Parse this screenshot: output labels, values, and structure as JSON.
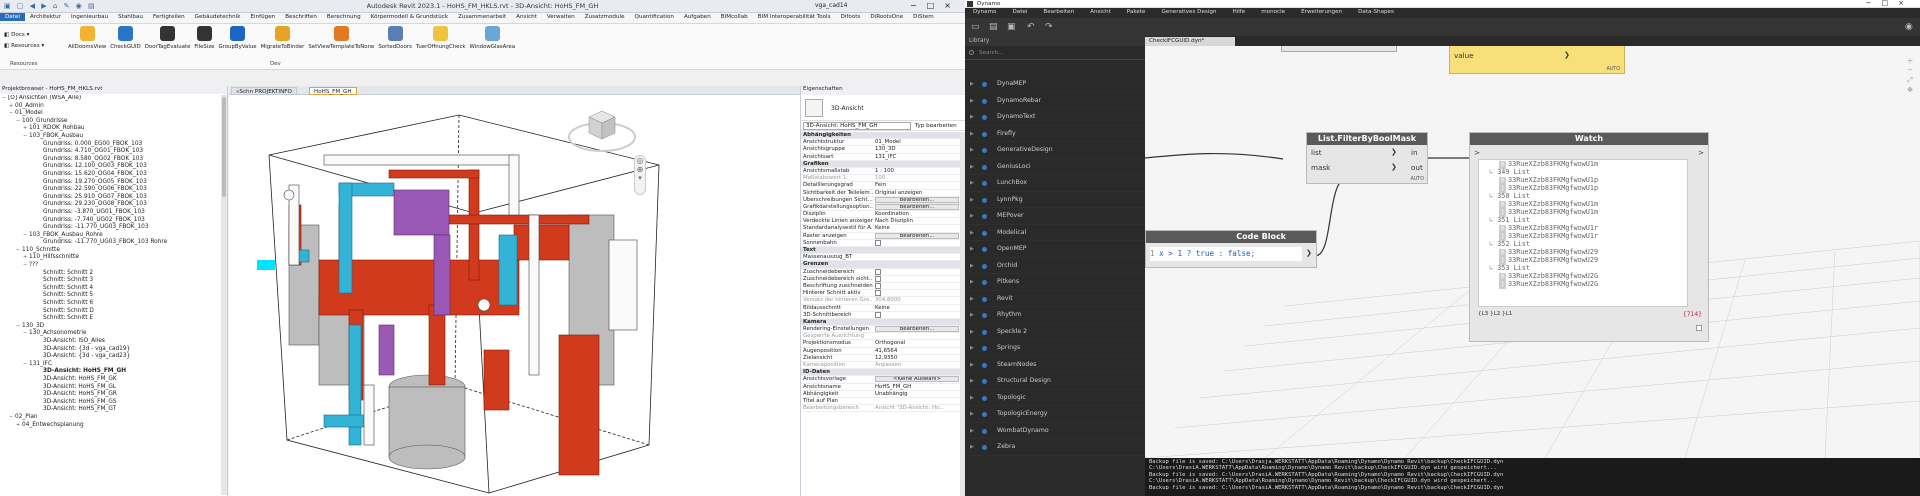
{
  "revit": {
    "window_title": "Autodesk Revit 2023.1 - HoHS_FM_HKLS.rvt - 3D-Ansicht: HoHS_FM_GH",
    "user": "vga_cad14",
    "menu": [
      "Datei",
      "Architektur",
      "Ingenieurbau",
      "Stahlbau",
      "Fertigteilen",
      "Gebäudetechnik",
      "Einfügen",
      "Beschriften",
      "Berechnung",
      "Körpermodell & Grundstück",
      "Zusammenarbeit",
      "Ansicht",
      "Verwalten",
      "Zusatzmodule",
      "Quantification",
      "Aufgaben",
      "BIMcollab",
      "BIM Interoperabilität Tools",
      "Difoots",
      "DiRootsOne",
      "DiStem"
    ],
    "ribbon_left": [
      "Docs",
      "Resources"
    ],
    "ribbon_buttons": [
      "AllDoomsView",
      "CheckGUID",
      "DoorTagEvaluate",
      "FileSize",
      "GroupByValue",
      "MigrateToBinder",
      "SetViewTemplateToNone",
      "SortedDoors",
      "TuerOffnungCheck",
      "WindowGlasArea"
    ],
    "ribbon_groups": [
      "Resources",
      "Dev"
    ],
    "project_browser_title": "Projektbrowser - HoHS_FM_HKLS.rvt",
    "tree": [
      {
        "t": "[O] Ansichten (WSA_Alle)",
        "l": 0,
        "tg": "−"
      },
      {
        "t": "00_Admin",
        "l": 1,
        "tg": "+"
      },
      {
        "t": "01_Model",
        "l": 1,
        "tg": "−"
      },
      {
        "t": "100_Grundrisse",
        "l": 2,
        "tg": "−"
      },
      {
        "t": "101_RDOK_Rohbau",
        "l": 3,
        "tg": "+"
      },
      {
        "t": "103_FBOK_Ausbau",
        "l": 3,
        "tg": "−"
      },
      {
        "t": "Grundriss: 0.000_EG00_FBOK_103",
        "l": 5,
        "tg": ""
      },
      {
        "t": "Grundriss: 4.710_OG01_FBOK_103",
        "l": 5,
        "tg": ""
      },
      {
        "t": "Grundriss: 8.580_OG02_FBOK_103",
        "l": 5,
        "tg": ""
      },
      {
        "t": "Grundriss: 12.100_OG03_FBOK_103",
        "l": 5,
        "tg": ""
      },
      {
        "t": "Grundriss: 15.620_OG04_FBOK_103",
        "l": 5,
        "tg": ""
      },
      {
        "t": "Grundriss: 19.270_OG05_FBOK_103",
        "l": 5,
        "tg": ""
      },
      {
        "t": "Grundriss: 22.590_OG06_FBOK_103",
        "l": 5,
        "tg": ""
      },
      {
        "t": "Grundriss: 25.910_OG07_FBOK_103",
        "l": 5,
        "tg": ""
      },
      {
        "t": "Grundriss: 29.230_OG08_FBOK_103",
        "l": 5,
        "tg": ""
      },
      {
        "t": "Grundriss: -3.870_UG01_FBOK_103",
        "l": 5,
        "tg": ""
      },
      {
        "t": "Grundriss: -7.740_UG02_FBOK_103",
        "l": 5,
        "tg": ""
      },
      {
        "t": "Grundriss: -11.770_UG03_FBOK_103",
        "l": 5,
        "tg": ""
      },
      {
        "t": "103_FBOK_Ausbau_Rohre",
        "l": 3,
        "tg": "−"
      },
      {
        "t": "Grundriss: -11.770_UG03_FBOK_103 Rohre",
        "l": 5,
        "tg": ""
      },
      {
        "t": "110_Schnitte",
        "l": 2,
        "tg": "−"
      },
      {
        "t": "110_Hilfsschnitte",
        "l": 3,
        "tg": "+"
      },
      {
        "t": "???",
        "l": 3,
        "tg": "−"
      },
      {
        "t": "Schnitt: Schnitt 2",
        "l": 5,
        "tg": ""
      },
      {
        "t": "Schnitt: Schnitt 3",
        "l": 5,
        "tg": ""
      },
      {
        "t": "Schnitt: Schnitt 4",
        "l": 5,
        "tg": ""
      },
      {
        "t": "Schnitt: Schnitt 5",
        "l": 5,
        "tg": ""
      },
      {
        "t": "Schnitt: Schnitt 6",
        "l": 5,
        "tg": ""
      },
      {
        "t": "Schnitt: Schnitt D",
        "l": 5,
        "tg": ""
      },
      {
        "t": "Schnitt: Schnitt E",
        "l": 5,
        "tg": ""
      },
      {
        "t": "130_3D",
        "l": 2,
        "tg": "−"
      },
      {
        "t": "130_Achsonometrie",
        "l": 3,
        "tg": "−"
      },
      {
        "t": "3D-Ansicht: ISO_Alles",
        "l": 5,
        "tg": ""
      },
      {
        "t": "3D-Ansicht: {3d - vga_cad19}",
        "l": 5,
        "tg": ""
      },
      {
        "t": "3D-Ansicht: {3d - vga_cad23}",
        "l": 5,
        "tg": ""
      },
      {
        "t": "131_IFC",
        "l": 3,
        "tg": "−"
      },
      {
        "t": "3D-Ansicht: HoHS_FM_GH",
        "l": 5,
        "tg": "",
        "b": true
      },
      {
        "t": "3D-Ansicht: HoHS_FM_GK",
        "l": 5,
        "tg": ""
      },
      {
        "t": "3D-Ansicht: HoHS_FM_GL",
        "l": 5,
        "tg": ""
      },
      {
        "t": "3D-Ansicht: HoHS_FM_GR",
        "l": 5,
        "tg": ""
      },
      {
        "t": "3D-Ansicht: HoHS_FM_GS",
        "l": 5,
        "tg": ""
      },
      {
        "t": "3D-Ansicht: HoHS_FM_GT",
        "l": 5,
        "tg": ""
      },
      {
        "t": "02_Plan",
        "l": 1,
        "tg": "−"
      },
      {
        "t": "04_Entwechsplanung",
        "l": 2,
        "tg": "+"
      }
    ],
    "view_tabs": [
      "«Schn PROJEKTINFO",
      "HoHS_FM_GH"
    ],
    "properties_title": "Eigenschaften",
    "prop_type": "3D-Ansicht",
    "prop_sel": "3D-Ansicht: HoHS_FM_GH",
    "prop_edit_type": "Typ bearbeiten",
    "props": [
      {
        "g": "Abhängigkeiten"
      },
      {
        "k": "Ansichtstruktur",
        "v": "01_Model"
      },
      {
        "k": "Ansichtsgruppe",
        "v": "130_3D"
      },
      {
        "k": "Ansichtsart",
        "v": "131_IFC"
      },
      {
        "g": "Grafiken"
      },
      {
        "k": "Ansichtsmaßstab",
        "v": "1 : 100"
      },
      {
        "k": "Maßstabswert 1:",
        "v": "100",
        "m": true
      },
      {
        "k": "Detaillierungsgrad",
        "v": "Fein"
      },
      {
        "k": "Sichtbarkeit der Teilelem...",
        "v": "Original anzeigen"
      },
      {
        "k": "Überschreibungen Sicht...",
        "v": "Bearbeiten...",
        "btn": true
      },
      {
        "k": "Grafikdarstellungsoption...",
        "v": "Bearbeiten...",
        "btn": true
      },
      {
        "k": "Disziplin",
        "v": "Koordination"
      },
      {
        "k": "Verdeckte Linien anzeigen",
        "v": "Nach Disziplin"
      },
      {
        "k": "Standardanalysestil für A...",
        "v": "Keine"
      },
      {
        "k": "Raster anzeigen",
        "v": "Bearbeiten...",
        "btn": true
      },
      {
        "k": "Sonnenbahn",
        "chk": true
      },
      {
        "g": "Text"
      },
      {
        "k": "Massenauszug_BT",
        "v": ""
      },
      {
        "g": "Grenzen"
      },
      {
        "k": "Zuschneidebereich",
        "chk": true
      },
      {
        "k": "Zuschneidebereich sicht...",
        "chk": true
      },
      {
        "k": "Beschriftung zuschneiden",
        "chk": true
      },
      {
        "k": "Hinterer Schnitt aktiv",
        "chk": true
      },
      {
        "k": "Versatz der hinteren Gre...",
        "v": "304,8000",
        "m": true
      },
      {
        "k": "Bildausschnitt",
        "v": "Keine"
      },
      {
        "k": "3D-Schnittbereich",
        "chk": true
      },
      {
        "g": "Kamera"
      },
      {
        "k": "Rendering-Einstellungen",
        "v": "Bearbeiten...",
        "btn": true
      },
      {
        "k": "Gesperrte Ausrichtung",
        "v": "",
        "m": true
      },
      {
        "k": "Projektionsmodus",
        "v": "Orthogonal"
      },
      {
        "k": "Augenposition",
        "v": "41,6564"
      },
      {
        "k": "Zielansicht",
        "v": "12,9350"
      },
      {
        "k": "Kameraposition",
        "v": "Anpassen",
        "m": true
      },
      {
        "g": "ID-Daten"
      },
      {
        "k": "Ansichtsvorlage",
        "v": "<Keine Auswahl>",
        "btn": true
      },
      {
        "k": "Ansichtsname",
        "v": "HoHS_FM_GH"
      },
      {
        "k": "Abhängigkeit",
        "v": "Unabhängig"
      },
      {
        "k": "Titel auf Plan",
        "v": ""
      },
      {
        "k": "Bearbeitungsbereich",
        "v": "Ansicht \"3D-Ansicht: Ho...",
        "m": true
      }
    ]
  },
  "dynamo": {
    "window_title": "Dynamo",
    "menu": [
      "Dynamo",
      "Datei",
      "Bearbeiten",
      "Ansicht",
      "Pakete",
      "Generatives Design",
      "Hilfe",
      "monocle",
      "Erweiterungen",
      "Data-Shapes"
    ],
    "library_title": "Library",
    "search_placeholder": "Search...",
    "library": [
      "DynaMEP",
      "DynamoRebar",
      "DynamoText",
      "Firefly",
      "GenerativeDesign",
      "GeniusLoci",
      "LunchBox",
      "LynnPkg",
      "MEPover",
      "Modelical",
      "OpenMEP",
      "Orchid",
      "Pitkens",
      "Revit",
      "Rhythm",
      "Speckle 2",
      "Springs",
      "SteamNodes",
      "Structural Design",
      "Topologic",
      "TopologicEnergy",
      "WombatDynamo",
      "Zebra"
    ],
    "ws_tab": "CheckIFCGUID.dyn*",
    "top_node_port": "value",
    "top_node_auto": "AUTO",
    "filter_node": {
      "title": "List.FilterByBoolMask",
      "in1": "list",
      "in2": "mask",
      "out1": "in",
      "out2": "out",
      "auto": "AUTO"
    },
    "code_node": {
      "title": "Code Block",
      "line_no": "1",
      "code": "x > 1 ? true : false;"
    },
    "watch_node": {
      "title": "Watch",
      "gt": ">",
      "footer": "{L3 }L2 }L1",
      "count": "{714}"
    },
    "watch_lines": [
      {
        "i": "0",
        "t": "33RueXZzb83FKMgfwowU1m",
        "ind": 2
      },
      {
        "i": "",
        "t": "349 List",
        "ind": 1
      },
      {
        "i": "0",
        "t": "33RueXZzb83FKMgfwowU1p",
        "ind": 2
      },
      {
        "i": "1",
        "t": "33RueXZzb83FKMgfwowU1p",
        "ind": 2
      },
      {
        "i": "",
        "t": "350 List",
        "ind": 1
      },
      {
        "i": "0",
        "t": "33RueXZzb83FKMgfwowU1m",
        "ind": 2
      },
      {
        "i": "1",
        "t": "33RueXZzb83FKMgfwowU1m",
        "ind": 2
      },
      {
        "i": "",
        "t": "351 List",
        "ind": 1
      },
      {
        "i": "0",
        "t": "33RueXZzb83FKMgfwowU1r",
        "ind": 2
      },
      {
        "i": "1",
        "t": "33RueXZzb83FKMgfwowU1r",
        "ind": 2
      },
      {
        "i": "",
        "t": "352 List",
        "ind": 1
      },
      {
        "i": "0",
        "t": "33RueXZzb83FKMgfwowU29",
        "ind": 2
      },
      {
        "i": "1",
        "t": "33RueXZzb83FKMgfwowU29",
        "ind": 2
      },
      {
        "i": "",
        "t": "353 List",
        "ind": 1
      },
      {
        "i": "0",
        "t": "33RueXZzb83FKMgfwowU2G",
        "ind": 2
      },
      {
        "i": "1",
        "t": "33RueXZzb83FKMgfwowU2G",
        "ind": 2
      }
    ],
    "console": [
      "Backup file is saved: C:\\Users\\Drasja.WERKSTATT\\AppData\\Roaming\\Dynamo\\Dynamo Revit\\backup\\CheckIFCGUID.dyn",
      "C:\\Users\\DrasiA.WERKSTATT\\AppData\\Roaming\\Dynamo\\Dynamo Revit\\backup\\CheckIFCGUID.dyn wird gespeichert...",
      "Backup file is saved: C:\\Users\\DrasiA.WERKSTATT\\AppData\\Roaming\\Dynamo\\Dynamo Revit\\backup\\CheckIFCGUID.dyn",
      "C:\\Users\\DrasiA.WERKSTATT\\AppData\\Roaming\\Dynamo\\Dynamo Revit\\backup\\CheckIFCGUID.dyn wird gespeichert...",
      "Backup file is saved: C:\\Users\\DrasiA.WERKSTATT\\AppData\\Roaming\\Dynamo\\Dynamo Revit\\backup\\CheckIFCGUID.dyn"
    ]
  },
  "colors": {
    "revit_blue": "#2a6ebb",
    "pipe_red": "#d23a1e",
    "pipe_cyan": "#33b3d6",
    "pipe_purple": "#9b59b6",
    "dynamo_dark": "#2a2a2a",
    "node_yellow": "#f7df7a"
  }
}
